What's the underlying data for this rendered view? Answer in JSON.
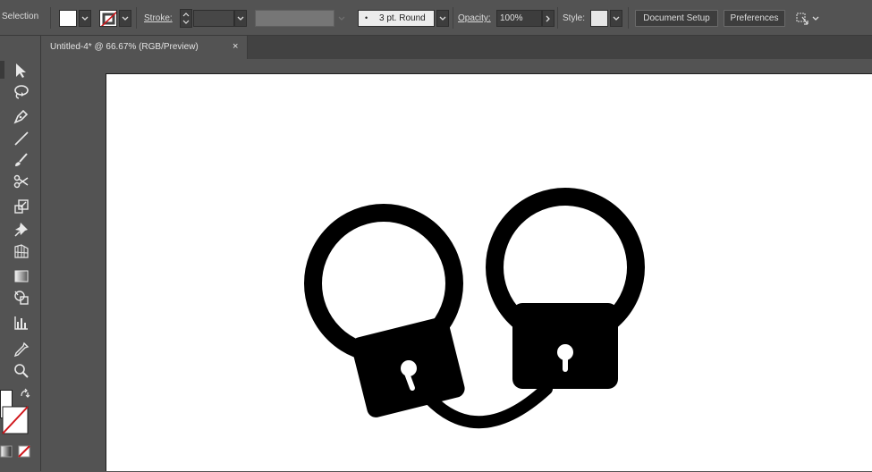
{
  "control_bar": {
    "selection_label": "Selection",
    "stroke_label": "Stroke:",
    "brush_label": "3 pt. Round",
    "opacity_label": "Opacity:",
    "opacity_value": "100%",
    "style_label": "Style:",
    "document_setup_label": "Document Setup",
    "preferences_label": "Preferences"
  },
  "tab": {
    "title": "Untitled-4* @ 66.67% (RGB/Preview)",
    "close_glyph": "×"
  },
  "colors": {
    "ui_bg": "#535353",
    "artboard": "#ffffff",
    "artwork": "#000000"
  },
  "tools": [
    "selection-tool-icon",
    "lasso-tool-icon",
    "pen-tool-icon",
    "line-tool-icon",
    "paintbrush-tool-icon",
    "scissors-tool-icon",
    "scale-tool-icon",
    "puppet-warp-tool-icon",
    "perspective-grid-tool-icon",
    "gradient-tool-icon",
    "shape-builder-tool-icon",
    "bar-graph-tool-icon",
    "eyedropper-tool-icon",
    "zoom-tool-icon"
  ],
  "artwork": {
    "subject": "handcuffs-icon"
  }
}
